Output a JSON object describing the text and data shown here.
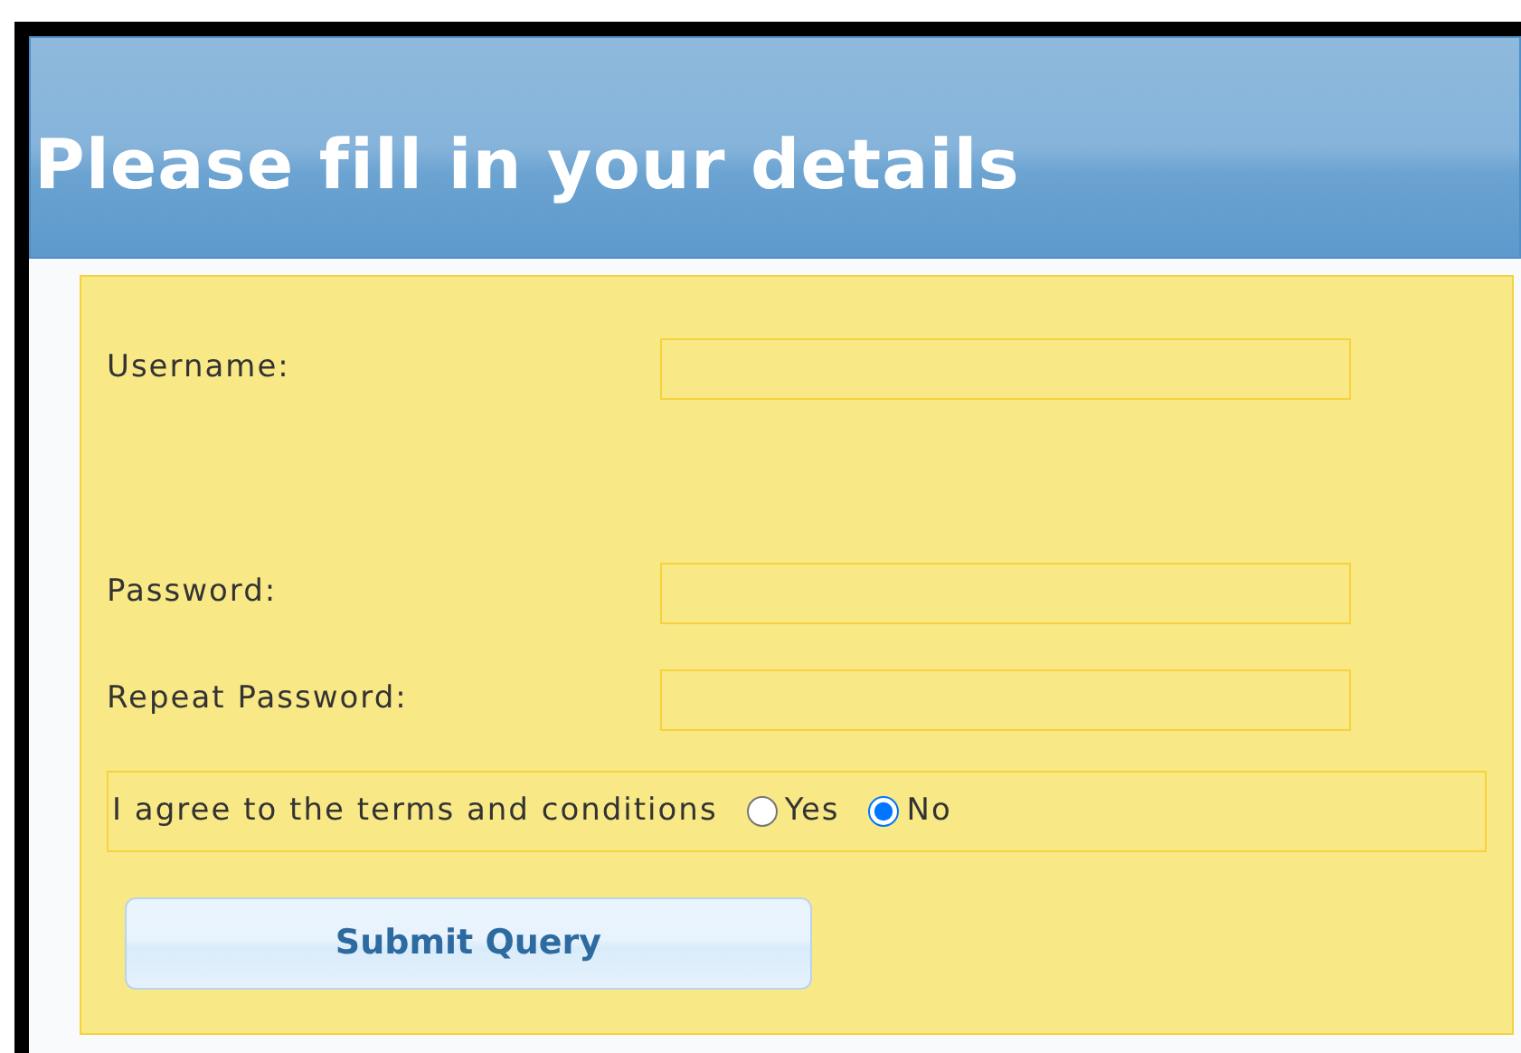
{
  "header": {
    "title": "Please fill in your details"
  },
  "fields": [
    {
      "label": "Username:"
    },
    {
      "label": "Password:"
    },
    {
      "label": "Repeat Password:"
    }
  ],
  "agreement": {
    "label": "I agree to the terms and conditions",
    "options": [
      {
        "label": "Yes",
        "selected": false
      },
      {
        "label": "No",
        "selected": true
      }
    ]
  },
  "submit": {
    "label": "Submit Query"
  }
}
